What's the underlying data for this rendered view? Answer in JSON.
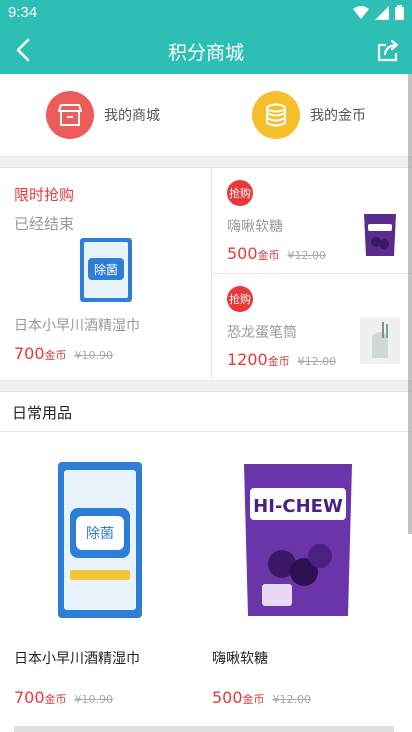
{
  "status": {
    "time": "9:34"
  },
  "header": {
    "title": "积分商城"
  },
  "quick": {
    "my_shop": "我的商城",
    "my_coins": "我的金币",
    "shop_color": "#ee5b5b",
    "coin_color": "#f5c02c"
  },
  "flash": {
    "tag": "限时抢购",
    "status": "已经结束",
    "main": {
      "name": "日本小早川酒精湿巾",
      "price": "700",
      "unit": "金币",
      "old": "¥10.90"
    },
    "items": [
      {
        "badge": "抢购",
        "name": "嗨啾软糖",
        "price": "500",
        "unit": "金币",
        "old": "¥12.00"
      },
      {
        "badge": "抢购",
        "name": "恐龙蛋笔筒",
        "price": "1200",
        "unit": "金币",
        "old": "¥12.00"
      }
    ]
  },
  "daily": {
    "title": "日常用品",
    "products": [
      {
        "name": "日本小早川酒精湿巾",
        "price": "700",
        "unit": "金币",
        "old": "¥10.90"
      },
      {
        "name": "嗨啾软糖",
        "price": "500",
        "unit": "金币",
        "old": "¥12.00"
      }
    ]
  },
  "product_labels": {
    "wipes_brand": "除菌",
    "candy_brand": "HI-CHEW"
  },
  "accent": "#2ebfb4",
  "price_color": "#e8393a"
}
